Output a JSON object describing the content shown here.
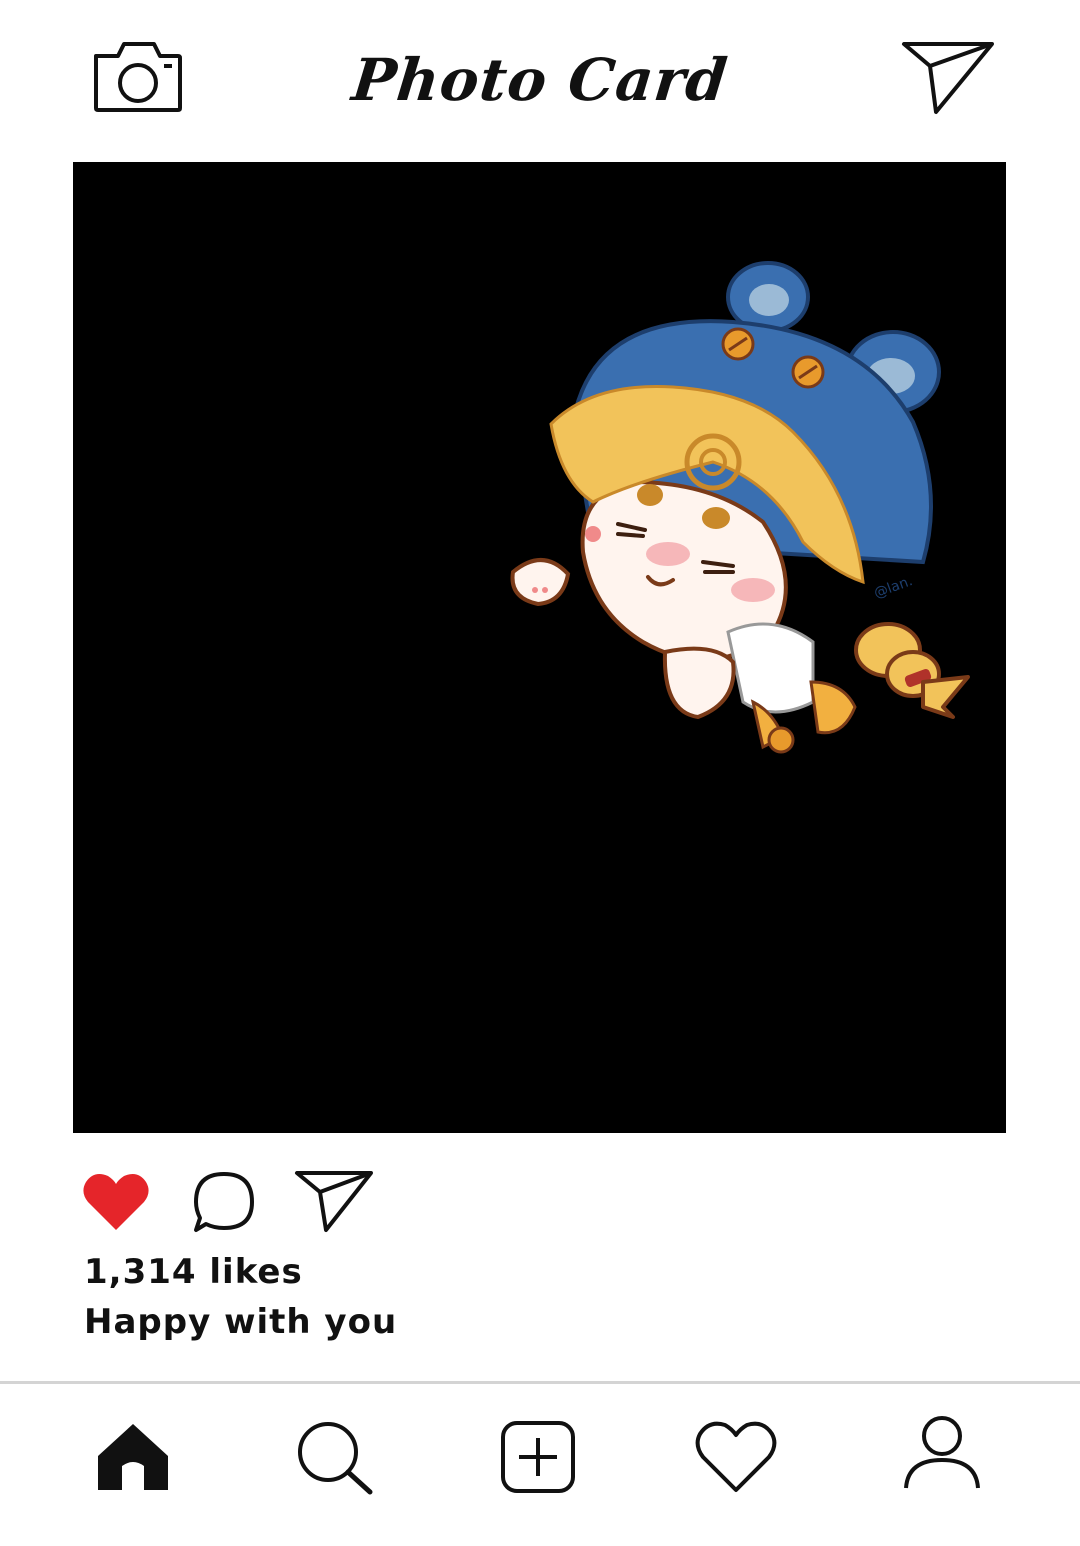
{
  "header": {
    "title": "Photo Card",
    "left_icon": "camera-icon",
    "right_icon": "send-icon"
  },
  "post": {
    "image_description_icon": "photo",
    "signature": "@lan.",
    "actions": {
      "like_icon": "heart-filled-icon",
      "comment_icon": "comment-icon",
      "share_icon": "send-icon",
      "like_color": "#e5252a"
    },
    "likes_text": "1,314 likes",
    "caption": "Happy with you"
  },
  "bottom_nav": {
    "items": [
      {
        "icon": "home-icon"
      },
      {
        "icon": "search-icon"
      },
      {
        "icon": "add-post-icon"
      },
      {
        "icon": "heart-outline-icon"
      },
      {
        "icon": "profile-icon"
      }
    ]
  },
  "colors": {
    "background": "#ffffff",
    "photo_background": "#000000",
    "hat_blue": "#3a6fb0",
    "hair_gold": "#f2c35a"
  }
}
